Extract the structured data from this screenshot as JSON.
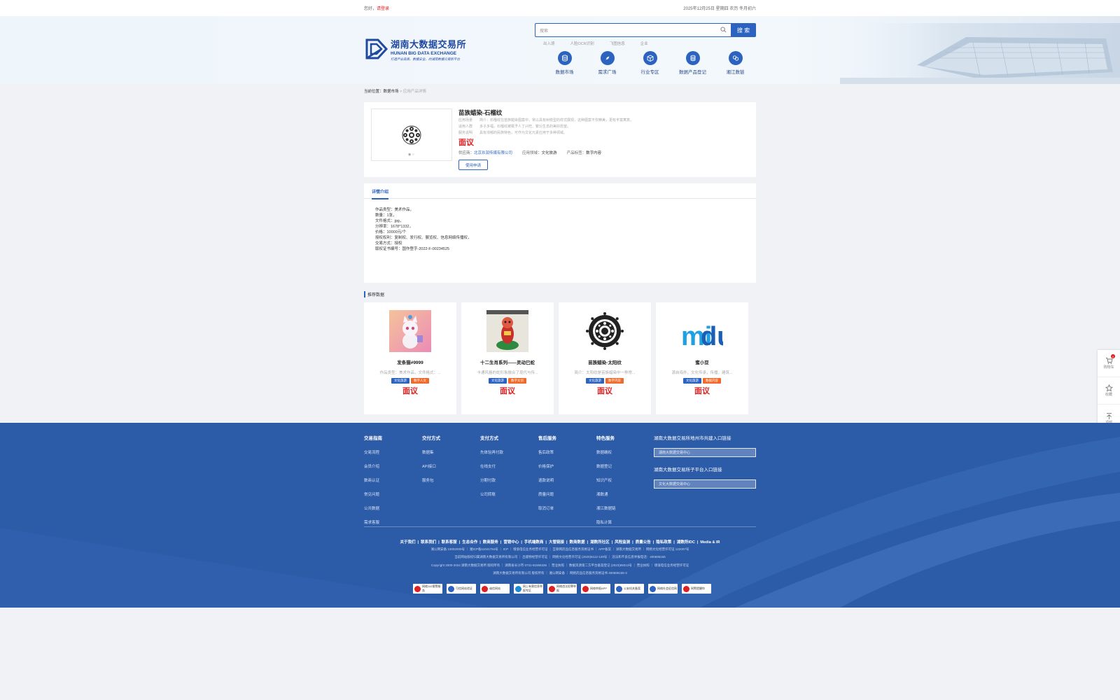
{
  "topbar": {
    "greeting": "您好，",
    "login": "请登录",
    "date": "2025年12月25日 星期四",
    "weather": "农历 冬月初六"
  },
  "logo": {
    "cn": "湖南大数据交易所",
    "en": "HUNAN BIG DATA EXCHANGE",
    "slogan": "打造产业高质、数据安全、的湖南数据交易新平台"
  },
  "search": {
    "placeholder": "搜索",
    "button": "搜 索",
    "hotwords": [
      "出入境",
      "人脸OCR识别",
      "飞图信息",
      "企业"
    ]
  },
  "nav": [
    {
      "label": "数据市场",
      "icon": "database-icon"
    },
    {
      "label": "需求广场",
      "icon": "compass-icon"
    },
    {
      "label": "行业专区",
      "icon": "cube-icon"
    },
    {
      "label": "数据产品登记",
      "icon": "stack-icon"
    },
    {
      "label": "湘江数链",
      "icon": "link-icon"
    }
  ],
  "breadcrumb": {
    "prefix": "当前位置：",
    "level1": "数据市场",
    "sep": ">",
    "current": "应用产品详情"
  },
  "product": {
    "title": "苗族蜡染-石榴纹",
    "rows": [
      {
        "k": "应用场景",
        "v": "简介：石榴纹在苗族蜡染图案中，常以具有树枝型的样式展现，这种图案不仅精美，更有丰富寓意。"
      },
      {
        "k": "适用人群",
        "v": "多子多福，石榴纹被赋予人丁兴旺、繁衍生息的美好愿望。"
      },
      {
        "k": "服务说明",
        "v": "具有浓郁的民族特色，可作为文化元素应用于多种领域。"
      }
    ],
    "price": "面议",
    "supplier_label": "供应商：",
    "supplier": "北京玖润传媒有限公司",
    "industry_label": "应用领域：",
    "industry": "文化旅游",
    "tag_label": "产品标签：",
    "tag": "数字内容",
    "apply": "使用申请",
    "dots": "◉ ○"
  },
  "detail": {
    "tab": "详情介绍",
    "lines": [
      "作品类型：美术作品，",
      "数量：1张，",
      "文件格式：jpg，",
      "分辨率：1678*1332，",
      "价格：10000元/个",
      "授权权利：复制权、发行权、展览权、信息网络传播权，",
      "交易方式：授权",
      "版权证书编号：国作登字-2022-F-00234525"
    ]
  },
  "recommend": {
    "title": "推荐数据",
    "items": [
      {
        "name": "发条猫#9999",
        "desc": "作品类型：美术作品，文件格式：...",
        "tags": [
          "文化旅游",
          "数字人文"
        ],
        "price": "面议"
      },
      {
        "name": "十二生肖系列——灵动巳蛇",
        "desc": "卡通风格的蛇形象融合了现代与传...",
        "tags": [
          "文化旅游",
          "数字文创"
        ],
        "price": "面议"
      },
      {
        "name": "苗族蜡染-太阳纹",
        "desc": "简介：太阳纹是苗族蜡染中一种常...",
        "tags": [
          "文化旅游",
          "数字内容"
        ],
        "price": "面议"
      },
      {
        "name": "蜜小豆",
        "desc": "源自海外，文化传承，传播，建筑...",
        "tags": [
          "文化旅游",
          "数据内容"
        ],
        "price": "面议"
      }
    ]
  },
  "float": {
    "cart": "购物车",
    "cart_count": "0",
    "fav": "收藏",
    "top": "顶部"
  },
  "footer": {
    "cols": [
      {
        "title": "交易指南",
        "items": [
          "交易流程",
          "会员介绍",
          "数商认证",
          "常见问题",
          "公共数据",
          "需求客服"
        ]
      },
      {
        "title": "交付方式",
        "items": [
          "数据集",
          "API接口",
          "服务包"
        ]
      },
      {
        "title": "支付方式",
        "items": [
          "先体验再付款",
          "在线支付",
          "分期付款",
          "公司转账"
        ]
      },
      {
        "title": "售后服务",
        "items": [
          "售后政策",
          "价格保护",
          "退款说明",
          "质量问题",
          "取消订单"
        ]
      },
      {
        "title": "特色服务",
        "items": [
          "数据确权",
          "数据登记",
          "知识产权",
          "湘数通",
          "湘江数据链",
          "隐私计算"
        ]
      }
    ],
    "entry1_label": "湖南大数据交易所地州市共建入口链接",
    "entry1_select": "湖南大数据交易中心",
    "entry2_label": "湖南大数据交易所子平台入口链接",
    "entry2_select": "文化大数据交易中心",
    "links": [
      "关于我们",
      "联系我们",
      "联系客服",
      "生态合作",
      "数商服务",
      "营销中心",
      "手机端数商",
      "大管链接",
      "数商数据",
      "湖数所社区",
      "风险监测",
      "质量公告",
      "隐私政策",
      "湖数所IDC",
      "Media & IR"
    ],
    "line1": "湖公网安备 10002000号 ｜ 湘ICP备11041794号 ｜ ICP ｜ 增值电信业务经营许可证 ｜ 互联网药品信息服务资格证书 ｜ APP备案 ｜ 湖南大数据交易所 ｜ 网络文化经营许可证 122007号",
    "line2": "当前网站版权归属湖南大数据交易所有限公司 ｜ 出版物经营许可证 ｜ 网络文化经营许可证 (2020)5112-129号 ｜ 违法和不良信息举报电话：400695155",
    "line3": "Copyright 2000-2024 湖南大数据交易所 版权所有 ｜ 湖南省长沙市 0731-81555336 ｜ 营业执照 ｜ 数据资源第二方平台备案登记 (2023)06013号 ｜ 营业执照 ｜ 增值电信业务经营许可证",
    "line4": "湖南大数据交易所有限公司 版权所有 ｜ 湘公网安备 ｜ 网络药品信息服务资格证书 400695155-3",
    "badges": [
      "网络110报警服务",
      "可信网站验证",
      "诚信网站",
      "网上有害信息举报专区",
      "网络违法犯罪举报",
      "网络举报APP",
      "公安机关备案",
      "网络社会征信网",
      "网警提醒你"
    ]
  }
}
